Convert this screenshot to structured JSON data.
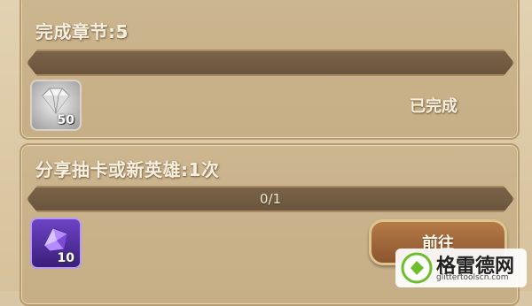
{
  "quests": [
    {
      "title": "完成章节:5",
      "progress_text": "",
      "progress_fraction": 0,
      "reward": {
        "icon": "silver-gem-icon",
        "count": "50"
      },
      "status": "已完成"
    },
    {
      "title": "分享抽卡或新英雄:1次",
      "progress_text": "0/1",
      "progress_fraction": 0,
      "reward": {
        "icon": "purple-crystal-icon",
        "count": "10"
      },
      "button_label": "前往"
    }
  ],
  "watermark": {
    "name": "格雷德网",
    "url": "glittertoolscn.com"
  },
  "colors": {
    "panel": "#c6ae86",
    "progress_track": "#6a553c",
    "button": "#8d5530"
  }
}
